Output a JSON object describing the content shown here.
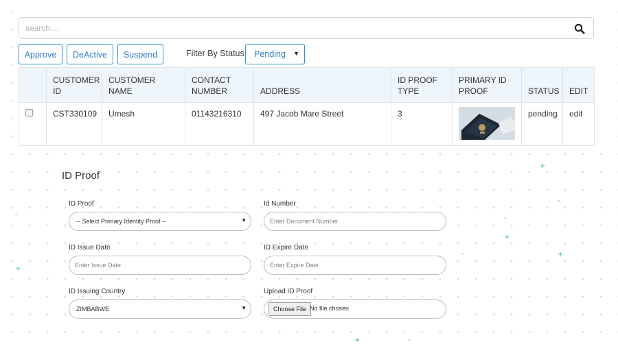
{
  "search": {
    "placeholder": "search...."
  },
  "actions": {
    "approve_label": "Approve",
    "deactive_label": "DeActive",
    "suspend_label": "Suspend",
    "filter_label": "Filter By Status",
    "filter_value": "Pending"
  },
  "table": {
    "headers": {
      "customer_id": "CUSTOMER ID",
      "customer_name": "CUSTOMER NAME",
      "contact_number": "CONTACT NUMBER",
      "address": "ADDRESS",
      "id_proof_type": "ID PROOF TYPE",
      "primary_id_proof": "PRIMARY ID PROOF",
      "status": "STATUS",
      "edit": "EDIT"
    },
    "rows": [
      {
        "customer_id": "CST330109",
        "customer_name": "Umesh",
        "contact_number": "01143216310",
        "address": "497 Jacob Mare Street",
        "id_proof_type": "3",
        "primary_id_proof_image": "passport-photo",
        "status": "pending",
        "edit": "edit"
      }
    ]
  },
  "form": {
    "title": "ID Proof",
    "id_proof": {
      "label": "ID Proof",
      "value": "-- Select Primary Identity Proof --"
    },
    "id_number": {
      "label": "Id Number",
      "placeholder": "Enter Document Number"
    },
    "issue_date": {
      "label": "ID Issue Date",
      "placeholder": "Enter Issue Date"
    },
    "expire_date": {
      "label": "ID Expire Date",
      "placeholder": "Enter Expire Date"
    },
    "issuing_country": {
      "label": "ID Issuing Country",
      "value": "ZIMBABWE"
    },
    "upload": {
      "label": "Upload ID Proof",
      "button": "Choose File",
      "status": "No file chosen"
    }
  },
  "colors": {
    "accent": "#2f8fd8",
    "link": "#3b4fd6",
    "header_bg": "#eef5fb"
  }
}
